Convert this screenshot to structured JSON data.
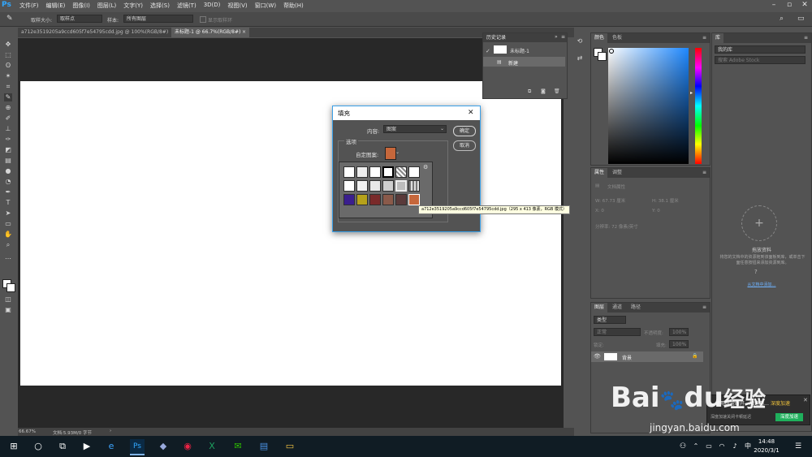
{
  "menubar": {
    "logo": "Ps",
    "items": [
      "文件(F)",
      "编辑(E)",
      "图像(I)",
      "图层(L)",
      "文字(Y)",
      "选择(S)",
      "滤镜(T)",
      "3D(D)",
      "视图(V)",
      "窗口(W)",
      "帮助(H)"
    ]
  },
  "options": {
    "sample_size_label": "取样大小:",
    "sample_size_value": "取样点",
    "sample_label": "样本:",
    "sample_value": "所有图层",
    "show_ring": "显示取样环"
  },
  "tabs": [
    {
      "label": "a712e3519205a9ccd605f7e54795cdd.jpg @ 100%(RGB/8#)"
    },
    {
      "label": "未标题-1 @ 66.7%(RGB/8#)"
    }
  ],
  "history": {
    "tab": "历史记录",
    "snapshot": "未标题-1",
    "state": "新建"
  },
  "color_panel": {
    "tab1": "颜色",
    "tab2": "色板"
  },
  "properties_panel": {
    "tab1": "属性",
    "tab2": "调整",
    "doc_label": "文档属性",
    "w": "W:  67.73 厘米",
    "h": "H:  38.1 厘米",
    "x": "X:  0",
    "y": "Y:  0",
    "resolution": "分辨率: 72 像素/英寸"
  },
  "layers_panel": {
    "tabs": [
      "图层",
      "通道",
      "路径"
    ],
    "kind": "类型",
    "blend": "正常",
    "opacity_label": "不透明度:",
    "opacity": "100%",
    "lock_label": "锁定:",
    "fill_label": "填充:",
    "fill": "100%",
    "layer_name": "背景"
  },
  "library": {
    "tab": "库",
    "dropdown": "我的库",
    "search_placeholder": "搜索 Adobe Stock",
    "title": "拖放资料",
    "desc": "将您的文档中的资源拖到该面板到库，或单击下面任意按钮来添加资源到库。",
    "link": "从文档中添加…"
  },
  "status": {
    "zoom": "66.67%",
    "doc": "文档:5.93M/0 字节"
  },
  "dialog": {
    "title": "填充",
    "content_label": "内容:",
    "content_value": "图案",
    "ok": "确定",
    "cancel": "取消",
    "options_label": "选项",
    "custom_pattern_label": "自定图案:",
    "tooltip": "a712e3519205a9ccd605f7e54795cdd.jpg（295 x 413 像素，RGB 模式）"
  },
  "notification": {
    "text": "…使用时常断开，加速用…",
    "sub": "深度加速关闭卡顿延迟",
    "btn1": "深度加速",
    "btn2": "深度加速"
  },
  "watermark": {
    "brand": "Bai",
    "paw": "du",
    "cn": "经验",
    "url": "jingyan.baidu.com"
  },
  "taskbar": {
    "time": "14:48",
    "date": "2020/3/1",
    "lang": "中"
  }
}
